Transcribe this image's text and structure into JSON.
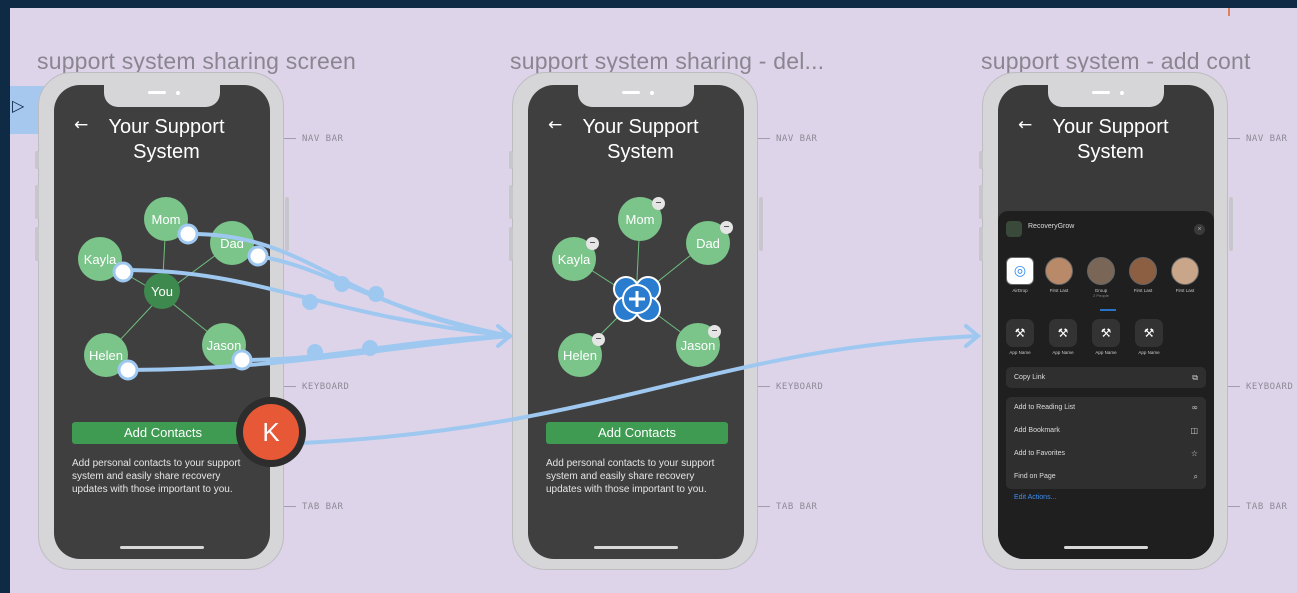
{
  "frames": [
    {
      "title": "support system sharing screen",
      "screen_title": "Your Support System",
      "back_icon": "←",
      "nodes": [
        "Mom",
        "Dad",
        "Kayla",
        "You",
        "Helen",
        "Jason"
      ],
      "button": "Add Contacts",
      "description": "Add personal contacts to your support system and easily share recovery updates with those important to you."
    },
    {
      "title": "support system sharing - del...",
      "screen_title": "Your Support System",
      "back_icon": "←",
      "nodes": [
        "Mom",
        "Dad",
        "Kayla",
        "Helen",
        "Jason"
      ],
      "button": "Add Contacts",
      "description": "Add personal contacts to your support system and easily share recovery updates with those important to you."
    },
    {
      "title": "support system - add cont",
      "screen_title": "Your Support System",
      "back_icon": "←",
      "share_sheet": {
        "app_name": "RecoveryGrow",
        "close": "×",
        "contacts": [
          {
            "name": "AirDrop",
            "sub": ""
          },
          {
            "name": "First Last",
            "sub": ""
          },
          {
            "name": "Group",
            "sub": "2 People"
          },
          {
            "name": "First Last",
            "sub": ""
          },
          {
            "name": "First Last",
            "sub": ""
          }
        ],
        "apps": [
          "App Name",
          "App Name",
          "App Name",
          "App Name"
        ],
        "copy_link": "Copy Link",
        "actions": [
          "Add to Reading List",
          "Add Bookmark",
          "Add to Favorites",
          "Find on Page"
        ],
        "edit_actions": "Edit Actions..."
      }
    }
  ],
  "side_labels": {
    "nav": "NAV BAR",
    "keyboard": "KEYBOARD",
    "tab": "TAB BAR"
  },
  "avatar": {
    "initial": "K",
    "color": "#e65836"
  },
  "icons": {
    "left_panel_toggle": "chevron-right-icon",
    "back": "arrow-left-icon",
    "add_contact": "plus-circle-icon",
    "copy": "copy-icon",
    "reading_list": "glasses-icon",
    "bookmark": "book-icon",
    "favorites": "star-icon",
    "find": "search-icon"
  },
  "colors": {
    "canvas": "#ddd4ea",
    "node": "#7bc58b",
    "node_center": "#3e8a4e",
    "button": "#3f9a52",
    "connector": "#9fc8f0"
  }
}
